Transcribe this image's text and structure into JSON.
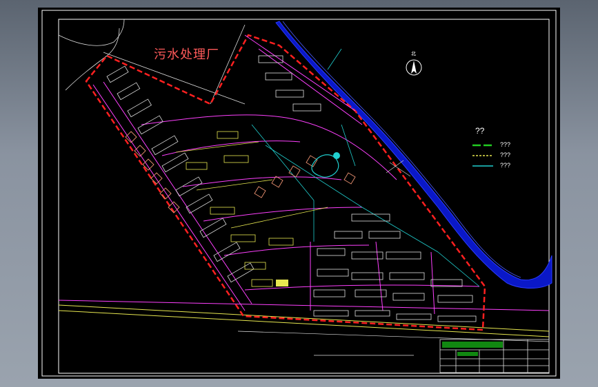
{
  "drawing": {
    "plant_label": "污水处理厂",
    "north_label": "北",
    "legend_title": "??",
    "legend_items": [
      {
        "label": "???",
        "color": "#22cc22"
      },
      {
        "label": "???",
        "color": "#e8e850"
      },
      {
        "label": "???",
        "color": "#20d0d0"
      }
    ]
  },
  "colors": {
    "boundary": "#ff2020",
    "road": "#ff40ff",
    "building": "#e0e0e0",
    "river": "#1020ff",
    "frame": "#ffffff"
  }
}
